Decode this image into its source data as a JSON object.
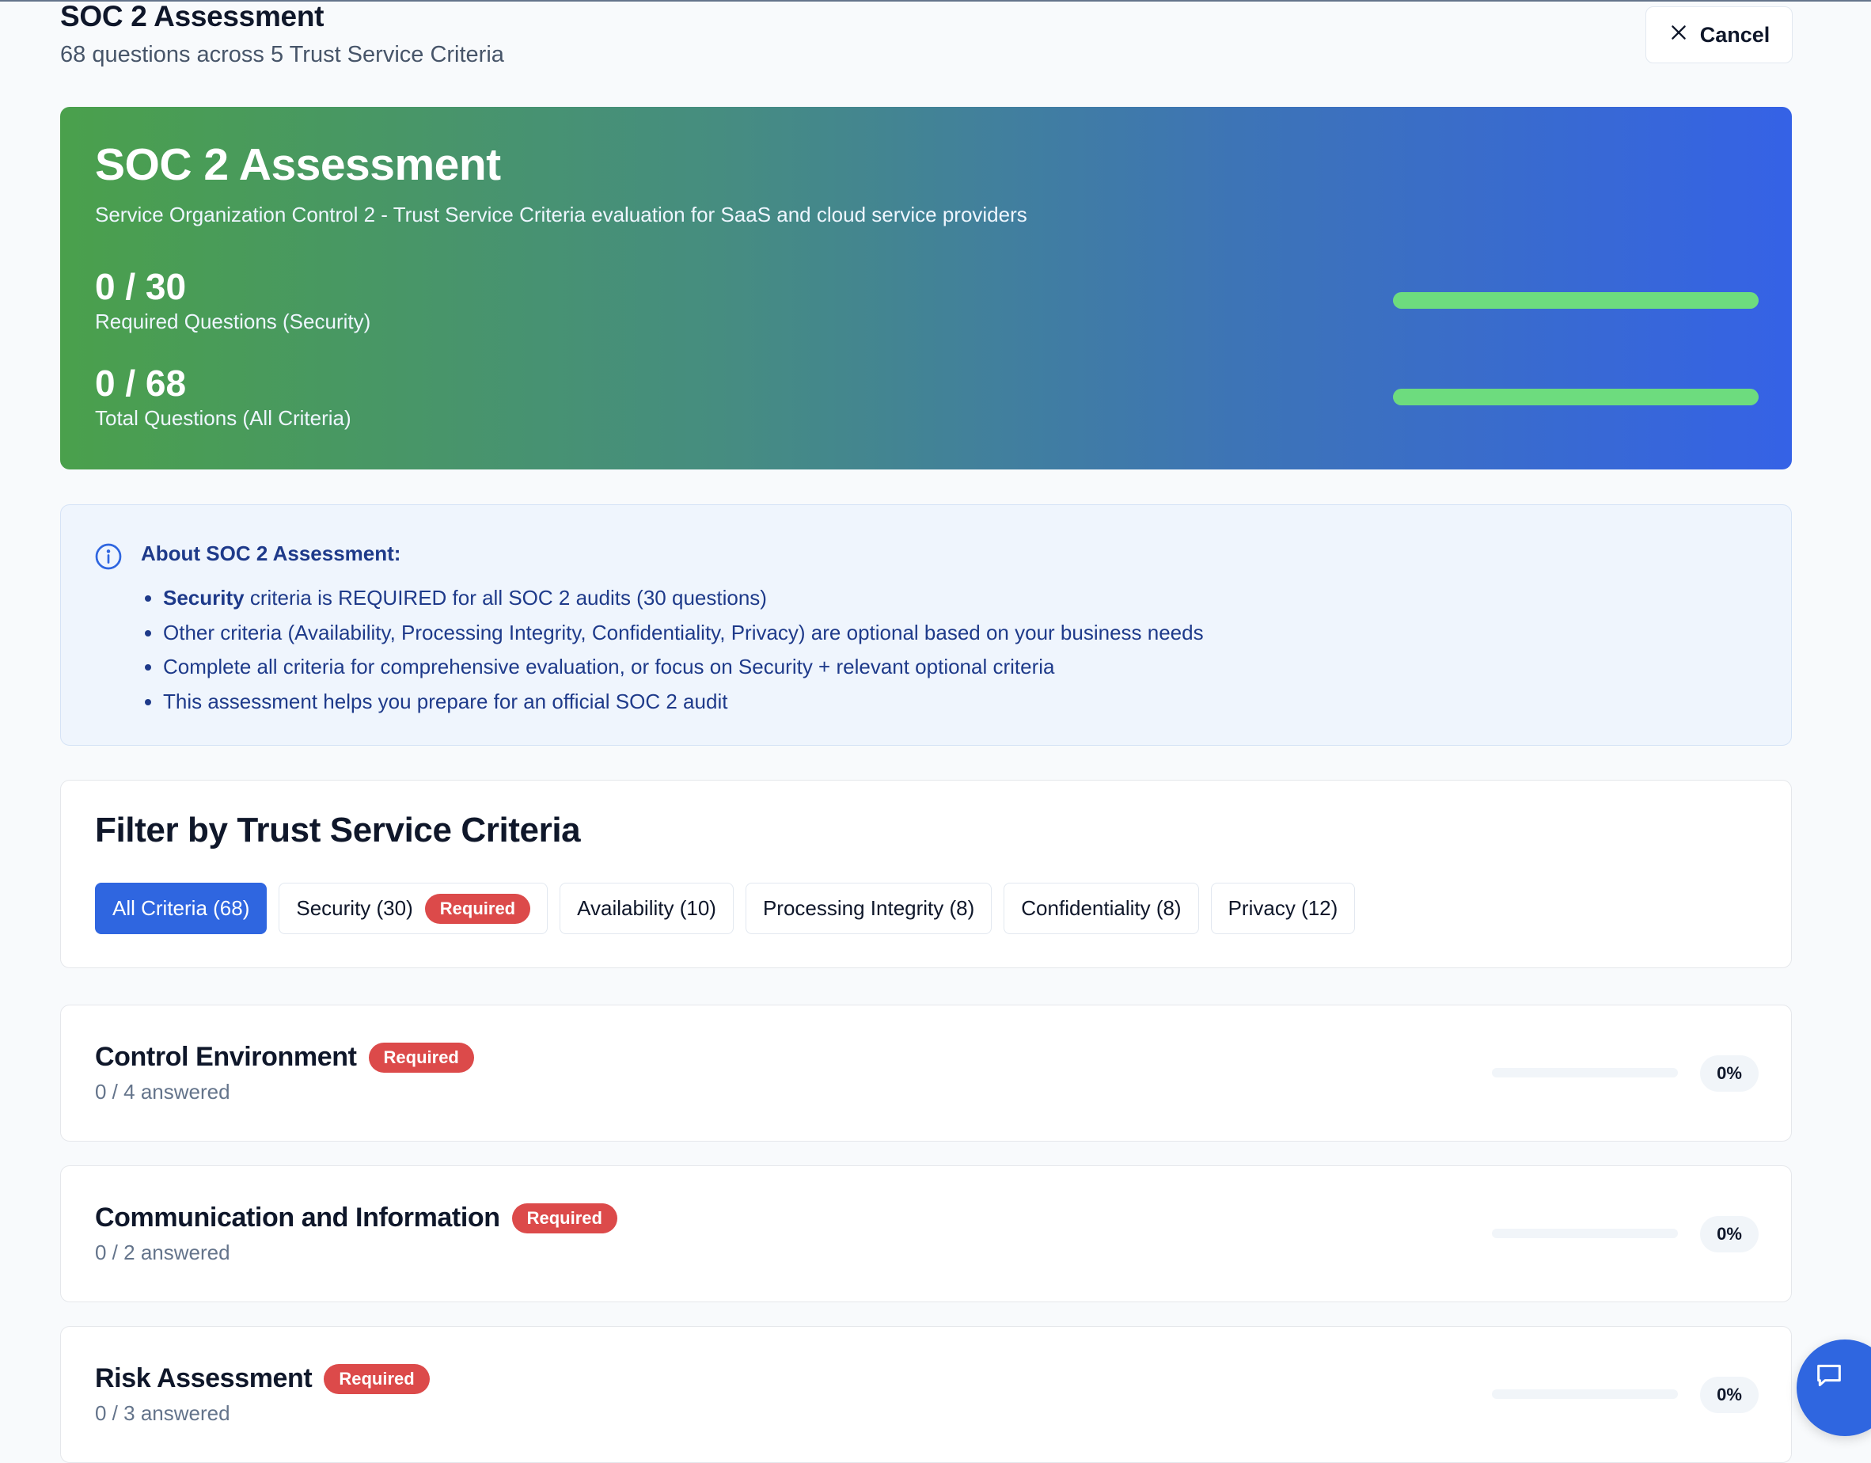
{
  "header": {
    "title": "SOC 2 Assessment",
    "subtitle": "68 questions across 5 Trust Service Criteria",
    "cancel_label": "Cancel"
  },
  "hero": {
    "title": "SOC 2 Assessment",
    "description": "Service Organization Control 2 - Trust Service Criteria evaluation for SaaS and cloud service providers",
    "stats": [
      {
        "value": "0 / 30",
        "label": "Required Questions (Security)",
        "progress": 1.0
      },
      {
        "value": "0 / 68",
        "label": "Total Questions (All Criteria)",
        "progress": 1.0
      }
    ],
    "bar_color": "#6ddc7e"
  },
  "info": {
    "title": "About SOC 2 Assessment:",
    "items": [
      {
        "bold": "Security",
        "text": " criteria is REQUIRED for all SOC 2 audits (30 questions)"
      },
      {
        "bold": "",
        "text": "Other criteria (Availability, Processing Integrity, Confidentiality, Privacy) are optional based on your business needs"
      },
      {
        "bold": "",
        "text": "Complete all criteria for comprehensive evaluation, or focus on Security + relevant optional criteria"
      },
      {
        "bold": "",
        "text": "This assessment helps you prepare for an official SOC 2 audit"
      }
    ]
  },
  "filter": {
    "title": "Filter by Trust Service Criteria",
    "chips": [
      {
        "label": "All Criteria (68)",
        "active": true,
        "badge": ""
      },
      {
        "label": "Security (30)",
        "active": false,
        "badge": "Required"
      },
      {
        "label": "Availability (10)",
        "active": false,
        "badge": ""
      },
      {
        "label": "Processing Integrity (8)",
        "active": false,
        "badge": ""
      },
      {
        "label": "Confidentiality (8)",
        "active": false,
        "badge": ""
      },
      {
        "label": "Privacy (12)",
        "active": false,
        "badge": ""
      }
    ]
  },
  "sections": [
    {
      "title": "Control Environment",
      "badge": "Required",
      "answered": "0 / 4 answered",
      "percent": "0%",
      "progress": 0
    },
    {
      "title": "Communication and Information",
      "badge": "Required",
      "answered": "0 / 2 answered",
      "percent": "0%",
      "progress": 0
    },
    {
      "title": "Risk Assessment",
      "badge": "Required",
      "answered": "0 / 3 answered",
      "percent": "0%",
      "progress": 0
    }
  ],
  "colors": {
    "accent": "#2f66e0",
    "required_badge": "#dc4a4a",
    "hero_gradient_start": "#4aa04c",
    "hero_gradient_end": "#3562e6"
  },
  "icons": {
    "cancel": "close-icon",
    "info": "info-circle-icon",
    "chat": "chat-bubble-icon"
  }
}
